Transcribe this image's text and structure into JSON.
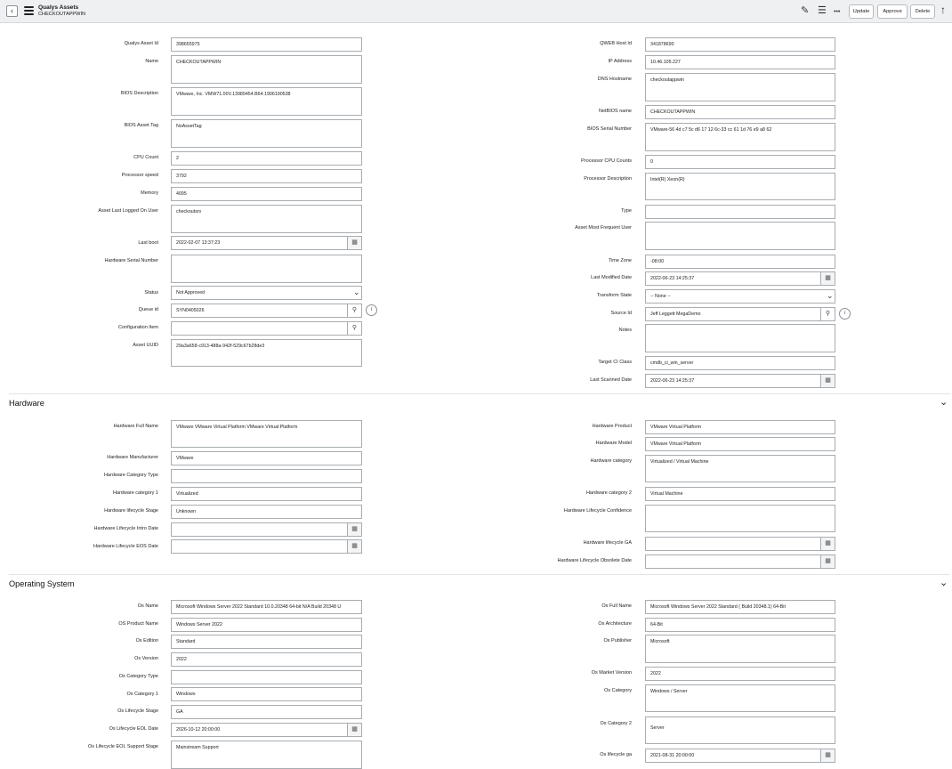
{
  "header": {
    "title": "Qualys Assets",
    "subtitle": "CHECKOUTAPPWIN",
    "back_glyph": "‹",
    "attach_glyph": "✎",
    "settings_glyph": "☰",
    "more_glyph": "•••",
    "update_label": "Update",
    "approve_label": "Approve",
    "delete_label": "Delete",
    "up_glyph": "↑"
  },
  "icons": {
    "calendar": "▦",
    "search": "⚲",
    "info": "i",
    "chevron": "⌄"
  },
  "general": {
    "left": {
      "asset_id": {
        "label": "Qualys Asset Id",
        "value": "398655975"
      },
      "name": {
        "label": "Name",
        "value": "CHECKOUTAPPWIN"
      },
      "bios_desc": {
        "label": "BIOS Description",
        "value": "VMware, Inc. VMW71.00V.13989454.B64.1906190538"
      },
      "bios_tag": {
        "label": "BIOS Asset Tag",
        "value": "NoAssetTag"
      },
      "cpu_count": {
        "label": "CPU Count",
        "value": "2"
      },
      "proc_speed": {
        "label": "Processor speed",
        "value": "3792"
      },
      "memory": {
        "label": "Memory",
        "value": "4095"
      },
      "last_user": {
        "label": "Asset Last Logged On User",
        "value": "checkoutsrv"
      },
      "last_boot": {
        "label": "Last boot",
        "value": "2022-02-07 13:37:23"
      },
      "hw_serial": {
        "label": "Hardware Serial Number",
        "value": ""
      },
      "status": {
        "label": "Status",
        "value": "Not Approved"
      },
      "queue_id": {
        "label": "Queue id",
        "value": "SYN0405026"
      },
      "config_item": {
        "label": "Configuration Item",
        "value": ""
      },
      "asset_uuid": {
        "label": "Asset UUID",
        "value": "29a3a658-c913-488a-942f-529c67b28de3"
      }
    },
    "right": {
      "qweb_host": {
        "label": "QWEB Host Id",
        "value": "341878690"
      },
      "ip": {
        "label": "IP Address",
        "value": "10.46.105.227"
      },
      "dns": {
        "label": "DNS Hostname",
        "value": "checkoutappwin"
      },
      "netbios": {
        "label": "NetBIOS name",
        "value": "CHECKOUTAPPWIN"
      },
      "bios_serial": {
        "label": "BIOS Serial Number",
        "value": "VMware-56 4d c7 5c d6 17 12 6c-33 cc 61 1d 76 e9 a8 62"
      },
      "proc_cpu": {
        "label": "Processor CPU Counts",
        "value": "0"
      },
      "proc_desc": {
        "label": "Processor Description",
        "value": "Intel(R) Xeon(R)"
      },
      "type": {
        "label": "Type",
        "value": ""
      },
      "freq_user": {
        "label": "Asset Most Frequent User",
        "value": ""
      },
      "tz": {
        "label": "Time Zone",
        "value": "-08:00"
      },
      "last_mod": {
        "label": "Last Modified Date",
        "value": "2022-06-23 14:25:37"
      },
      "transform": {
        "label": "Transform State",
        "value": "-- None --"
      },
      "source_id": {
        "label": "Source Id",
        "value": "Jeff Leggett MegaDemo"
      },
      "notes": {
        "label": "Notes",
        "value": ""
      },
      "target_ci": {
        "label": "Target CI Class",
        "value": "cmdb_ci_win_server"
      },
      "last_scan": {
        "label": "Last Scanned Date",
        "value": "2022-06-23 14:25:37"
      }
    }
  },
  "hardware": {
    "title": "Hardware",
    "left": {
      "full_name": {
        "label": "Hardware Full Name",
        "value": "VMware VMware Virtual Platform VMware Virtual Platform"
      },
      "manufacturer": {
        "label": "Hardware Manufacturer",
        "value": "VMware"
      },
      "cat_type": {
        "label": "Hardware Category Type",
        "value": ""
      },
      "cat1": {
        "label": "Hardware category 1",
        "value": "Virtualized"
      },
      "lifecycle": {
        "label": "Hardware lifecycle Stage",
        "value": "Unknown"
      },
      "intro": {
        "label": "Hardware Lifecycle Intro Date",
        "value": ""
      },
      "eos": {
        "label": "Hardware Lifecycle EOS Date",
        "value": ""
      }
    },
    "right": {
      "product": {
        "label": "Hardware Product",
        "value": "VMware Virtual Platform"
      },
      "model": {
        "label": "Hardware Model",
        "value": "VMware Virtual Platform"
      },
      "category": {
        "label": "Hardware category",
        "value": "Virtualized / Virtual Machine"
      },
      "cat2": {
        "label": "Hardware category 2",
        "value": "Virtual Machine"
      },
      "confidence": {
        "label": "Hardware Lifecycle Confidence",
        "value": ""
      },
      "ga": {
        "label": "Hardware lifecycle GA",
        "value": ""
      },
      "obsolete": {
        "label": "Hardware Lifecycle Obsolete Date",
        "value": ""
      }
    }
  },
  "os": {
    "title": "Operating System",
    "left": {
      "name": {
        "label": "Os Name",
        "value": "Microsoft Windows Server 2022 Standard 10.0.20348 64-bit N/A Build 20348 U"
      },
      "product": {
        "label": "OS Product Name",
        "value": "Windows Server 2022"
      },
      "edition": {
        "label": "Os Edition",
        "value": "Standard"
      },
      "version": {
        "label": "Os Version",
        "value": "2022"
      },
      "cat_type": {
        "label": "Os Category Type",
        "value": ""
      },
      "cat1": {
        "label": "Os Category 1",
        "value": "Windows"
      },
      "lifecycle": {
        "label": "Os Lifecycle Stage",
        "value": "GA"
      },
      "eol": {
        "label": "Os Lifecycle EOL Date",
        "value": "2026-10-12 20:00:00"
      },
      "eol_support": {
        "label": "Os Lifecycle EOL Support Stage",
        "value": "Mainstream Support"
      }
    },
    "right": {
      "full_name": {
        "label": "Os Full Name",
        "value": "Microsoft Windows Server 2022 Standard ( Build 20348.1) 64-Bit"
      },
      "arch": {
        "label": "Os Architecture",
        "value": "64-Bit"
      },
      "publisher": {
        "label": "Os Publisher",
        "value": "Microsoft"
      },
      "market": {
        "label": "Os Market Version",
        "value": "2022"
      },
      "category": {
        "label": "Os Category",
        "value": "Windows / Server"
      },
      "cat2": {
        "label": "Os Category 2",
        "value": "Server"
      },
      "ga": {
        "label": "Os lifecycle ga",
        "value": "2021-08-31 20:00:00"
      }
    }
  }
}
